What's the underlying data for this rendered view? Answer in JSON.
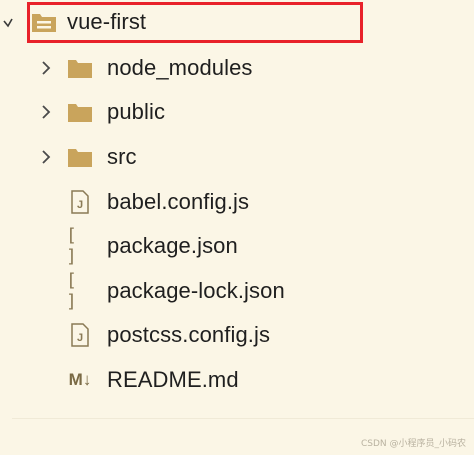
{
  "explorer": {
    "root": {
      "label": "vue-first",
      "icon": "folder-open-icon"
    },
    "items": [
      {
        "label": "node_modules",
        "type": "folder",
        "icon": "folder-icon"
      },
      {
        "label": "public",
        "type": "folder",
        "icon": "folder-icon"
      },
      {
        "label": "src",
        "type": "folder",
        "icon": "folder-icon"
      },
      {
        "label": "babel.config.js",
        "type": "file",
        "icon": "js-file-icon"
      },
      {
        "label": "package.json",
        "type": "file",
        "icon": "json-file-icon"
      },
      {
        "label": "package-lock.json",
        "type": "file",
        "icon": "json-file-icon"
      },
      {
        "label": "postcss.config.js",
        "type": "file",
        "icon": "js-file-icon"
      },
      {
        "label": "README.md",
        "type": "file",
        "icon": "markdown-file-icon"
      }
    ]
  },
  "watermark": "CSDN @小程序员_小码农",
  "colors": {
    "background": "#fbf6e6",
    "highlight_border": "#e8222a",
    "folder": "#c9a45c",
    "icon_ink": "#8a7a55",
    "text": "#1f1f1f"
  },
  "icons": {
    "js_file_glyph": "J",
    "json_file_glyph": "[ ]",
    "markdown_glyph": "M↓"
  }
}
